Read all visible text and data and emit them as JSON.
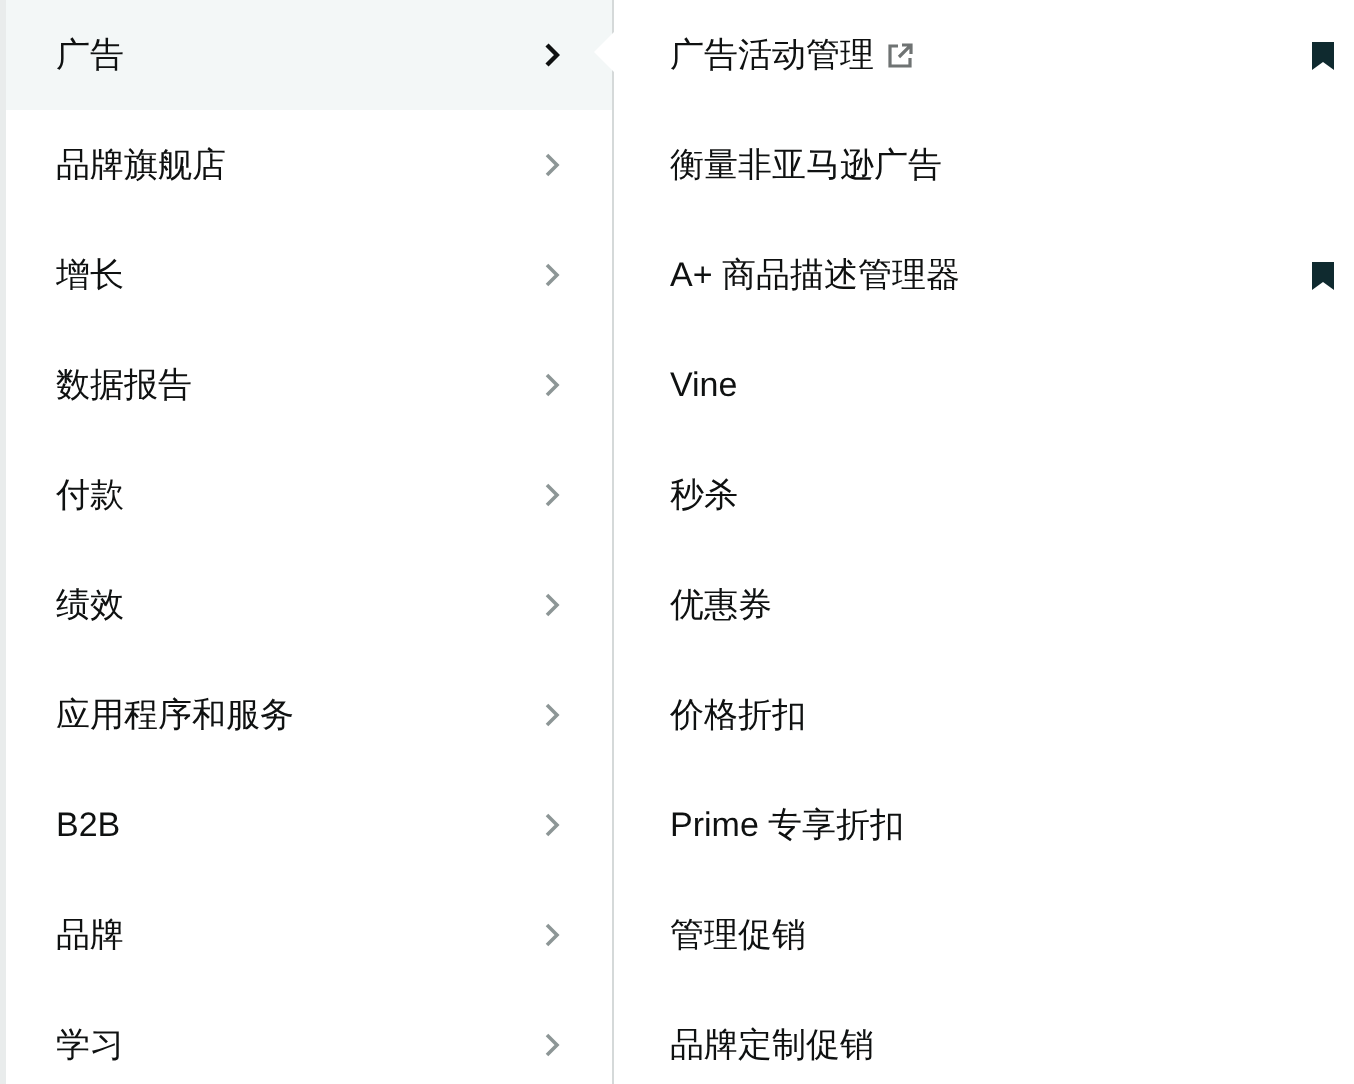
{
  "menu": [
    {
      "label": "广告",
      "selected": true
    },
    {
      "label": "品牌旗舰店",
      "selected": false
    },
    {
      "label": "增长",
      "selected": false
    },
    {
      "label": "数据报告",
      "selected": false
    },
    {
      "label": "付款",
      "selected": false
    },
    {
      "label": "绩效",
      "selected": false
    },
    {
      "label": "应用程序和服务",
      "selected": false
    },
    {
      "label": "B2B",
      "selected": false
    },
    {
      "label": "品牌",
      "selected": false
    },
    {
      "label": "学习",
      "selected": false
    }
  ],
  "submenu": [
    {
      "label": "广告活动管理",
      "external": true,
      "bookmarked": true
    },
    {
      "label": "衡量非亚马逊广告",
      "external": false,
      "bookmarked": false
    },
    {
      "label": "A+ 商品描述管理器",
      "external": false,
      "bookmarked": true
    },
    {
      "label": "Vine",
      "external": false,
      "bookmarked": false
    },
    {
      "label": "秒杀",
      "external": false,
      "bookmarked": false
    },
    {
      "label": "优惠券",
      "external": false,
      "bookmarked": false
    },
    {
      "label": "价格折扣",
      "external": false,
      "bookmarked": false
    },
    {
      "label": "Prime 专享折扣",
      "external": false,
      "bookmarked": false
    },
    {
      "label": "管理促销",
      "external": false,
      "bookmarked": false
    },
    {
      "label": "品牌定制促销",
      "external": false,
      "bookmarked": false
    }
  ]
}
